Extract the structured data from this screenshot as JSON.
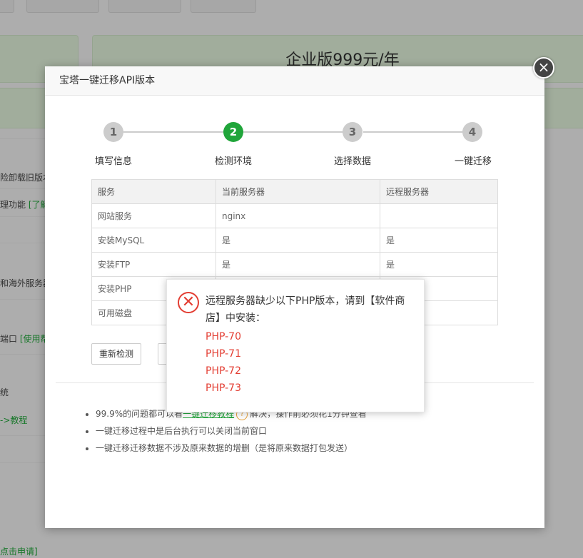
{
  "background": {
    "plan_title": "企业版999元/年",
    "left_texts": [
      "险卸载旧版本",
      "理功能",
      "[了解",
      "和海外服务器",
      "端口",
      "[使用帮",
      "统",
      "->教程",
      "点击申请]"
    ]
  },
  "dialog": {
    "title": "宝塔一键迁移API版本",
    "close_symbol": "×",
    "steps": [
      {
        "num": "1",
        "label": "填写信息"
      },
      {
        "num": "2",
        "label": "检测环境"
      },
      {
        "num": "3",
        "label": "选择数据"
      },
      {
        "num": "4",
        "label": "一键迁移"
      }
    ],
    "active_step": 2,
    "table": {
      "headers": [
        "服务",
        "当前服务器",
        "远程服务器"
      ],
      "rows": [
        [
          "网站服务",
          "nginx",
          ""
        ],
        [
          "安装MySQL",
          "是",
          "是"
        ],
        [
          "安装FTP",
          "是",
          "是"
        ],
        [
          "安装PHP",
          "",
          ""
        ],
        [
          "可用磁盘",
          "",
          ""
        ]
      ]
    },
    "recheck_label": "重新检测",
    "tips": {
      "tip1_prefix": "99.9%的问题都可以看",
      "tip1_link": "一键迁移教程",
      "tip1_suffix": "解决，操作前必须花1分钟查看",
      "tip2": "一键迁移过程中是后台执行可以关闭当前窗口",
      "tip3": "一键迁移迁移数据不涉及原来数据的增删（是将原来数据打包发送）"
    }
  },
  "alert": {
    "icon_symbol": "✕",
    "message": "远程服务器缺少以下PHP版本，请到【软件商店】中安装：",
    "versions": [
      "PHP-70",
      "PHP-71",
      "PHP-72",
      "PHP-73"
    ]
  },
  "colors": {
    "accent": "#20a53a",
    "error": "#e33e33"
  }
}
